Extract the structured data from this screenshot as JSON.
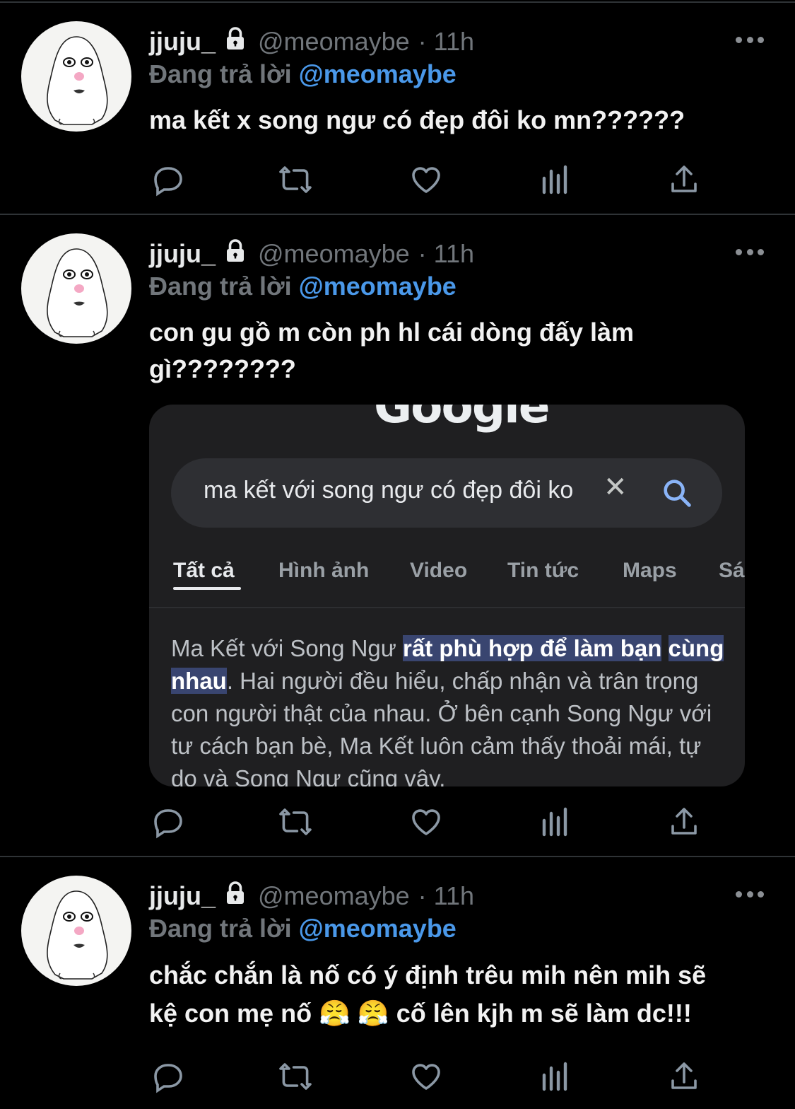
{
  "tweets": [
    {
      "name": "jjuju_",
      "handle": "@meomaybe",
      "time": "· 11h",
      "reply_prefix": "Đang trả lời",
      "reply_to": "@meomaybe",
      "text": "ma kết x song ngư có đẹp đôi ko mn??????"
    },
    {
      "name": "jjuju_",
      "handle": "@meomaybe",
      "time": "· 11h",
      "reply_prefix": "Đang trả lời",
      "reply_to": "@meomaybe",
      "text_line1": "con gu gồ m còn ph hl cái dòng đấy làm",
      "text_line2": "gì????????"
    },
    {
      "name": "jjuju_",
      "handle": "@meomaybe",
      "time": "· 11h",
      "reply_prefix": "Đang trả lời",
      "reply_to": "@meomaybe",
      "text_line1": "chắc chắn là nố có ý định trêu mih nên mih sẽ",
      "text_line2": "kệ con mẹ nố 😤 😤 cố lên kjh m sẽ làm dc!!!"
    }
  ],
  "google": {
    "logo": "Google",
    "query": "ma kết với song ngư có đẹp đôi ko",
    "tabs": [
      "Tất cả",
      "Hình ảnh",
      "Video",
      "Tin tức",
      "Maps",
      "Sá"
    ],
    "active_tab": "Tất cả",
    "snippet_pre": "Ma Kết với Song Ngư ",
    "snippet_highlight1": "rất phù hợp để làm bạn",
    "snippet_highlight2": "cùng nhau",
    "snippet_post": ". Hai người đều hiểu, chấp nhận và trân trọng con người thật của nhau. Ở bên cạnh Song Ngư với tư cách bạn bè, Ma Kết luôn cảm thấy thoải mái, tự do và Song Ngư cũng vậy."
  },
  "icons": {
    "reply": "reply-icon",
    "retweet": "retweet-icon",
    "like": "heart-icon",
    "views": "analytics-icon",
    "share": "share-icon",
    "more": "more-icon",
    "lock": "lock-icon"
  },
  "colors": {
    "mention": "#4a98e9",
    "muted": "#71767b",
    "highlight": "#394570"
  }
}
